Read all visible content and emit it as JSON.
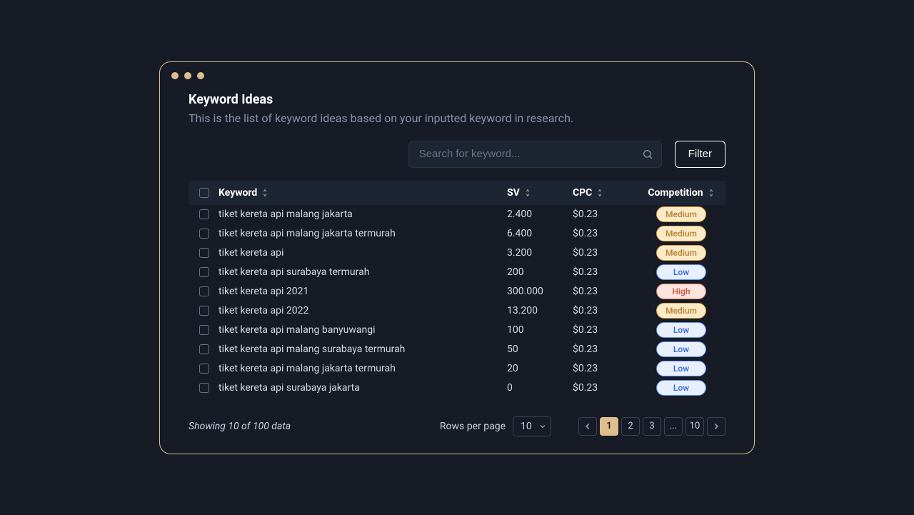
{
  "header": {
    "title": "Keyword Ideas",
    "subtitle": "This is the list of keyword ideas based on your inputted keyword in research."
  },
  "toolbar": {
    "search_placeholder": "Search for keyword...",
    "filter_label": "Filter"
  },
  "table": {
    "columns": {
      "keyword": "Keyword",
      "sv": "SV",
      "cpc": "CPC",
      "competition": "Competition"
    },
    "rows": [
      {
        "keyword": "tiket kereta api malang jakarta",
        "sv": "2.400",
        "cpc": "$0.23",
        "competition": "Medium"
      },
      {
        "keyword": "tiket kereta api malang jakarta termurah",
        "sv": "6.400",
        "cpc": "$0.23",
        "competition": "Medium"
      },
      {
        "keyword": "tiket kereta api",
        "sv": "3.200",
        "cpc": "$0.23",
        "competition": "Medium"
      },
      {
        "keyword": "tiket kereta api surabaya termurah",
        "sv": "200",
        "cpc": "$0.23",
        "competition": "Low"
      },
      {
        "keyword": "tiket kereta api 2021",
        "sv": "300.000",
        "cpc": "$0.23",
        "competition": "High"
      },
      {
        "keyword": "tiket kereta api 2022",
        "sv": "13.200",
        "cpc": "$0.23",
        "competition": "Medium"
      },
      {
        "keyword": "tiket kereta api malang banyuwangi",
        "sv": "100",
        "cpc": "$0.23",
        "competition": "Low"
      },
      {
        "keyword": "tiket kereta api malang surabaya termurah",
        "sv": "50",
        "cpc": "$0.23",
        "competition": "Low"
      },
      {
        "keyword": "tiket kereta api malang jakarta termurah",
        "sv": "20",
        "cpc": "$0.23",
        "competition": "Low"
      },
      {
        "keyword": "tiket kereta api surabaya jakarta",
        "sv": "0",
        "cpc": "$0.23",
        "competition": "Low"
      }
    ]
  },
  "footer": {
    "status": "Showing 10 of 100 data",
    "rpp_label": "Rows per page",
    "rpp_value": "10",
    "pages": [
      "1",
      "2",
      "3",
      "...",
      "10"
    ],
    "active_page": "1"
  }
}
